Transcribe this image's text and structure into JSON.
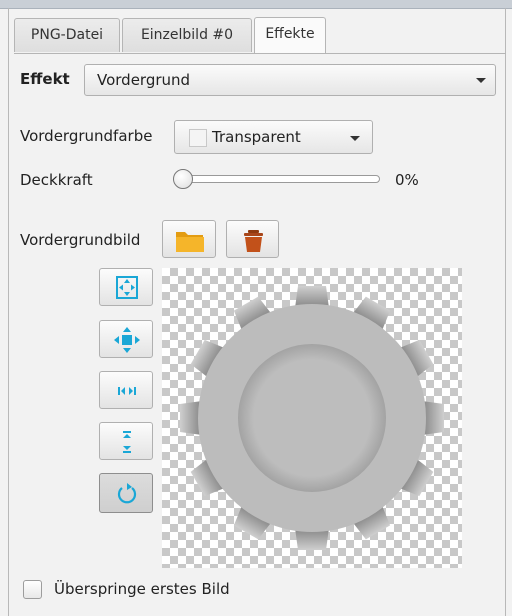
{
  "tabs": [
    {
      "label": "PNG-Datei"
    },
    {
      "label": "Einzelbild #0"
    },
    {
      "label": "Effekte",
      "active": true
    }
  ],
  "effect": {
    "label": "Effekt",
    "selected": "Vordergrund"
  },
  "foreground_color": {
    "label": "Vordergrundfarbe",
    "selected": "Transparent"
  },
  "opacity": {
    "label": "Deckkraft",
    "value_text": "0%",
    "value": 0
  },
  "foreground_image": {
    "label": "Vordergrundbild",
    "open_icon": "folder-icon",
    "delete_icon": "trash-icon"
  },
  "image_tools": [
    {
      "name": "fit-icon"
    },
    {
      "name": "center-icon"
    },
    {
      "name": "stretch-horizontal-icon"
    },
    {
      "name": "stretch-vertical-icon"
    },
    {
      "name": "rotate-icon",
      "pressed": true
    }
  ],
  "preview": {
    "icon": "gear-icon"
  },
  "skip_first": {
    "label": "Überspringe erstes Bild",
    "checked": false
  },
  "colors": {
    "accent": "#1aa7d6",
    "folder": "#f5b52a",
    "trash": "#c2511a"
  }
}
